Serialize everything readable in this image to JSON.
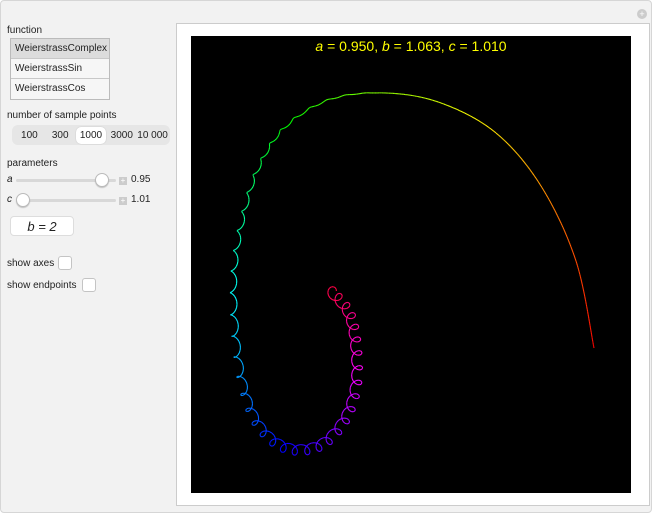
{
  "controls": {
    "function_label": "function",
    "functions": [
      "WeierstrassComplex",
      "WeierstrassSin",
      "WeierstrassCos"
    ],
    "function_selected": "WeierstrassComplex",
    "samples_label": "number of sample points",
    "samples": [
      "100",
      "300",
      "1000",
      "3000",
      "10 000"
    ],
    "samples_selected": "1000",
    "parameters_label": "parameters",
    "a": {
      "label": "a",
      "value": "0.95",
      "fraction": 0.92
    },
    "c": {
      "label": "c",
      "value": "1.01",
      "fraction": 0.0
    },
    "b_button": "b = 2",
    "show_axes": {
      "label": "show axes",
      "checked": false
    },
    "show_endpoints": {
      "label": "show endpoints",
      "checked": false
    }
  },
  "plot": {
    "title": {
      "a_label": "a",
      "a": "0.950",
      "b_label": "b",
      "b": "1.063",
      "c_label": "c",
      "c": "1.010"
    },
    "background": "#000000",
    "title_color": "#ffff00",
    "curve_coloring": "hue gradient red→yellow→green→cyan→blue→magenta→red"
  }
}
